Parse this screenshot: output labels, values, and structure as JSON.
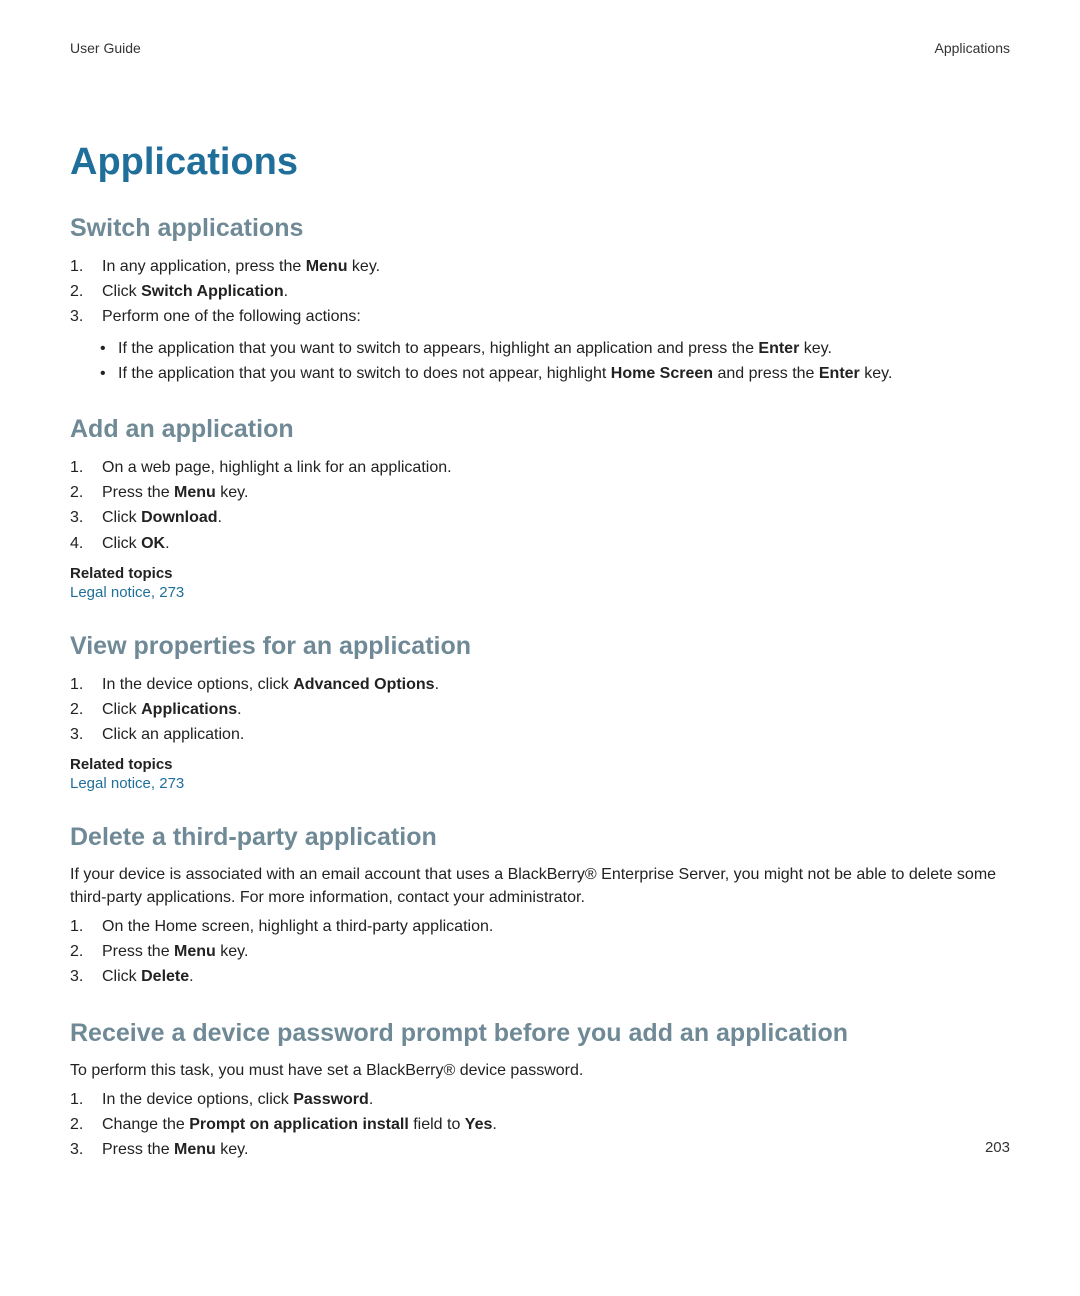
{
  "header": {
    "left": "User Guide",
    "right": "Applications"
  },
  "chapter_title": "Applications",
  "page_number": "203",
  "sections": [
    {
      "heading": "Switch applications",
      "steps": [
        {
          "pre": "In any application, press the ",
          "bold": "Menu",
          "post": " key."
        },
        {
          "pre": "Click ",
          "bold": "Switch Application",
          "post": "."
        },
        {
          "pre": "Perform one of the following actions:",
          "bold": "",
          "post": ""
        }
      ],
      "sub_bullets": [
        {
          "pre": "If the application that you want to switch to appears, highlight an application and press the ",
          "bold": "Enter",
          "post": " key."
        },
        {
          "pre": "If the application that you want to switch to does not appear, highlight ",
          "bold": "Home Screen",
          "mid": " and press the ",
          "bold2": "Enter",
          "post": " key."
        }
      ]
    },
    {
      "heading": "Add an application",
      "steps": [
        {
          "pre": "On a web page, highlight a link for an application.",
          "bold": "",
          "post": ""
        },
        {
          "pre": "Press the ",
          "bold": "Menu",
          "post": " key."
        },
        {
          "pre": "Click ",
          "bold": "Download",
          "post": "."
        },
        {
          "pre": "Click ",
          "bold": "OK",
          "post": "."
        }
      ],
      "related_label": "Related topics",
      "related_link": "Legal notice, 273"
    },
    {
      "heading": "View properties for an application",
      "steps": [
        {
          "pre": "In the device options, click ",
          "bold": "Advanced Options",
          "post": "."
        },
        {
          "pre": "Click ",
          "bold": "Applications",
          "post": "."
        },
        {
          "pre": "Click an application.",
          "bold": "",
          "post": ""
        }
      ],
      "related_label": "Related topics",
      "related_link": "Legal notice, 273"
    },
    {
      "heading": "Delete a third-party application",
      "intro": "If your device is associated with an email account that uses a BlackBerry® Enterprise Server, you might not be able to delete some third-party applications. For more information, contact your administrator.",
      "steps": [
        {
          "pre": "On the Home screen, highlight a third-party application.",
          "bold": "",
          "post": ""
        },
        {
          "pre": "Press the ",
          "bold": "Menu",
          "post": " key."
        },
        {
          "pre": "Click ",
          "bold": "Delete",
          "post": "."
        }
      ]
    },
    {
      "heading": "Receive a device password prompt before you add an application",
      "intro": "To perform this task, you must have set a BlackBerry® device password.",
      "steps": [
        {
          "pre": "In the device options, click ",
          "bold": "Password",
          "post": "."
        },
        {
          "pre": "Change the ",
          "bold": "Prompt on application install",
          "mid": " field to ",
          "bold2": "Yes",
          "post": "."
        },
        {
          "pre": "Press the ",
          "bold": "Menu",
          "post": " key."
        }
      ]
    }
  ]
}
